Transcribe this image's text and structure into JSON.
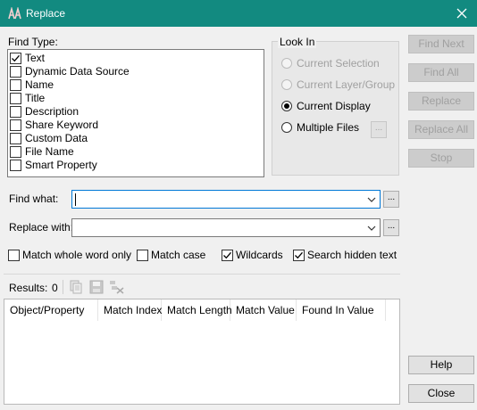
{
  "window": {
    "title": "Replace",
    "close_icon": "close-icon",
    "app_icon": "app-icon"
  },
  "find_type": {
    "label": "Find Type:",
    "items": [
      {
        "label": "Text",
        "checked": true
      },
      {
        "label": "Dynamic Data Source",
        "checked": false
      },
      {
        "label": "Name",
        "checked": false
      },
      {
        "label": "Title",
        "checked": false
      },
      {
        "label": "Description",
        "checked": false
      },
      {
        "label": "Share Keyword",
        "checked": false
      },
      {
        "label": "Custom Data",
        "checked": false
      },
      {
        "label": "File Name",
        "checked": false
      },
      {
        "label": "Smart Property",
        "checked": false
      }
    ]
  },
  "look_in": {
    "label": "Look In",
    "options": [
      {
        "label": "Current Selection",
        "enabled": false,
        "selected": false
      },
      {
        "label": "Current Layer/Group",
        "enabled": false,
        "selected": false
      },
      {
        "label": "Current Display",
        "enabled": true,
        "selected": true
      },
      {
        "label": "Multiple Files",
        "enabled": true,
        "selected": false
      }
    ],
    "browse_label": "..."
  },
  "buttons": {
    "find_next": "Find Next",
    "find_all": "Find All",
    "replace": "Replace",
    "replace_all": "Replace All",
    "stop": "Stop",
    "help": "Help",
    "close": "Close"
  },
  "find_what": {
    "label": "Find what:",
    "value": "",
    "browse_label": "..."
  },
  "replace_with": {
    "label": "Replace with:",
    "value": "",
    "browse_label": "..."
  },
  "options": [
    {
      "label": "Match whole word only",
      "checked": false
    },
    {
      "label": "Match case",
      "checked": false
    },
    {
      "label": "Wildcards",
      "checked": true
    },
    {
      "label": "Search hidden text",
      "checked": true
    }
  ],
  "results": {
    "label": "Results:",
    "count": "0",
    "columns": [
      "Object/Property",
      "Match Index",
      "Match Length",
      "Match Value",
      "Found In Value"
    ]
  },
  "colors": {
    "titlebar": "#128a80",
    "accent": "#0078d7"
  }
}
